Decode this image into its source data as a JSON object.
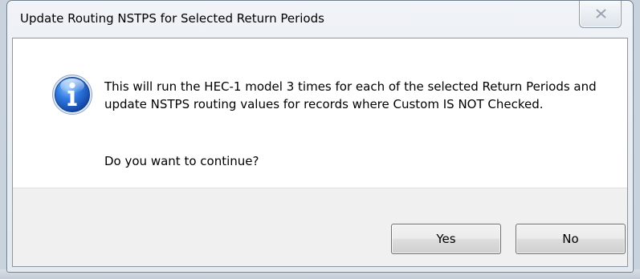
{
  "dialog": {
    "title": "Update Routing NSTPS for Selected Return Periods",
    "message": "This will run the HEC-1 model 3 times for each of the selected Return Periods and update NSTPS routing values for records where Custom IS NOT Checked.",
    "question": "Do you want to continue?",
    "icon": "info-icon",
    "buttons": {
      "yes_label": "Yes",
      "no_label": "No"
    }
  },
  "colors": {
    "icon_blue": "#1f5fc4",
    "button_bar": "#f0f0f0",
    "frame": "#e3e9ef"
  }
}
